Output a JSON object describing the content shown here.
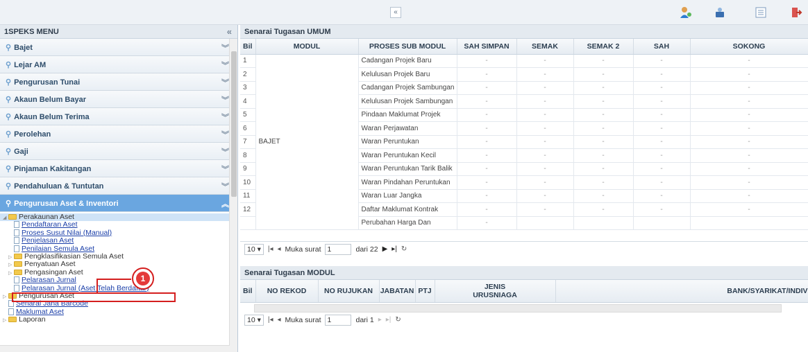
{
  "topbar": {
    "collapse_glyph": "«",
    "icons": [
      "user-icon",
      "person-lock-icon",
      "list-icon",
      "logout-icon"
    ]
  },
  "sidebar": {
    "title": "1SPEKS MENU",
    "collapse_glyph": "«",
    "items": [
      {
        "label": "Bajet"
      },
      {
        "label": "Lejar AM"
      },
      {
        "label": "Pengurusan Tunai"
      },
      {
        "label": "Akaun Belum Bayar"
      },
      {
        "label": "Akaun Belum Terima"
      },
      {
        "label": "Perolehan"
      },
      {
        "label": "Gaji"
      },
      {
        "label": "Pinjaman Kakitangan"
      },
      {
        "label": "Pendahuluan & Tuntutan"
      },
      {
        "label": "Pengurusan Aset & Inventori"
      }
    ],
    "tree": {
      "perakaunan": "Perakaunan Aset",
      "pendaftaran": "Pendaftaran Aset",
      "proses_susut": "Proses Susut Nilai (Manual)",
      "penjelasan": "Penjelasan Aset",
      "penilaian": "Penilaian Semula Aset",
      "pengklasifikasian": "Pengklasifikasian Semula Aset",
      "penyatuan": "Penyatuan Aset",
      "pengasingan": "Pengasingan Aset",
      "pelarasan": "Pelarasan Jurnal",
      "pelarasan_telah": "Pelarasan Jurnal (Aset Telah Berdaftar)",
      "pengurusan": "Pengurusan Aset",
      "senarai_barcode": "Senarai Jana Barcode",
      "maklumat": "Maklumat Aset",
      "laporan": "Laporan"
    }
  },
  "callout": {
    "number": "1"
  },
  "umum": {
    "title": "Senarai Tugasan UMUM",
    "headers": [
      "Bil",
      "MODUL",
      "PROSES SUB MODUL",
      "SAH SIMPAN",
      "SEMAK",
      "SEMAK 2",
      "SAH",
      "SOKONG"
    ],
    "modul": "BAJET",
    "rows": [
      {
        "bil": "1",
        "proses": "Cadangan Projek Baru"
      },
      {
        "bil": "2",
        "proses": "Kelulusan Projek Baru"
      },
      {
        "bil": "3",
        "proses": "Cadangan Projek Sambungan"
      },
      {
        "bil": "4",
        "proses": "Kelulusan Projek Sambungan"
      },
      {
        "bil": "5",
        "proses": "Pindaan Maklumat Projek"
      },
      {
        "bil": "6",
        "proses": "Waran Perjawatan"
      },
      {
        "bil": "7",
        "proses": "Waran Peruntukan"
      },
      {
        "bil": "8",
        "proses": "Waran Peruntukan Kecil"
      },
      {
        "bil": "9",
        "proses": "Waran Peruntukan Tarik Balik"
      },
      {
        "bil": "10",
        "proses": "Waran Pindahan Peruntukan"
      },
      {
        "bil": "11",
        "proses": "Waran Luar Jangka"
      },
      {
        "bil": "12",
        "proses": "Daftar Maklumat Kontrak"
      },
      {
        "bil": "",
        "proses": "Perubahan Harga Dan"
      }
    ],
    "dash": "-",
    "pager": {
      "size": "10",
      "page_label": "Muka surat",
      "page": "1",
      "of_label": "dari 22"
    }
  },
  "modul": {
    "title": "Senarai Tugasan MODUL",
    "headers": [
      "Bil",
      "NO REKOD",
      "NO RUJUKAN",
      "JABATAN",
      "PTJ",
      "JENIS URUSNIAGA",
      "BANK/SYARIKAT/INDIV"
    ],
    "pager": {
      "size": "10",
      "page_label": "Muka surat",
      "page": "1",
      "of_label": "dari 1"
    }
  }
}
